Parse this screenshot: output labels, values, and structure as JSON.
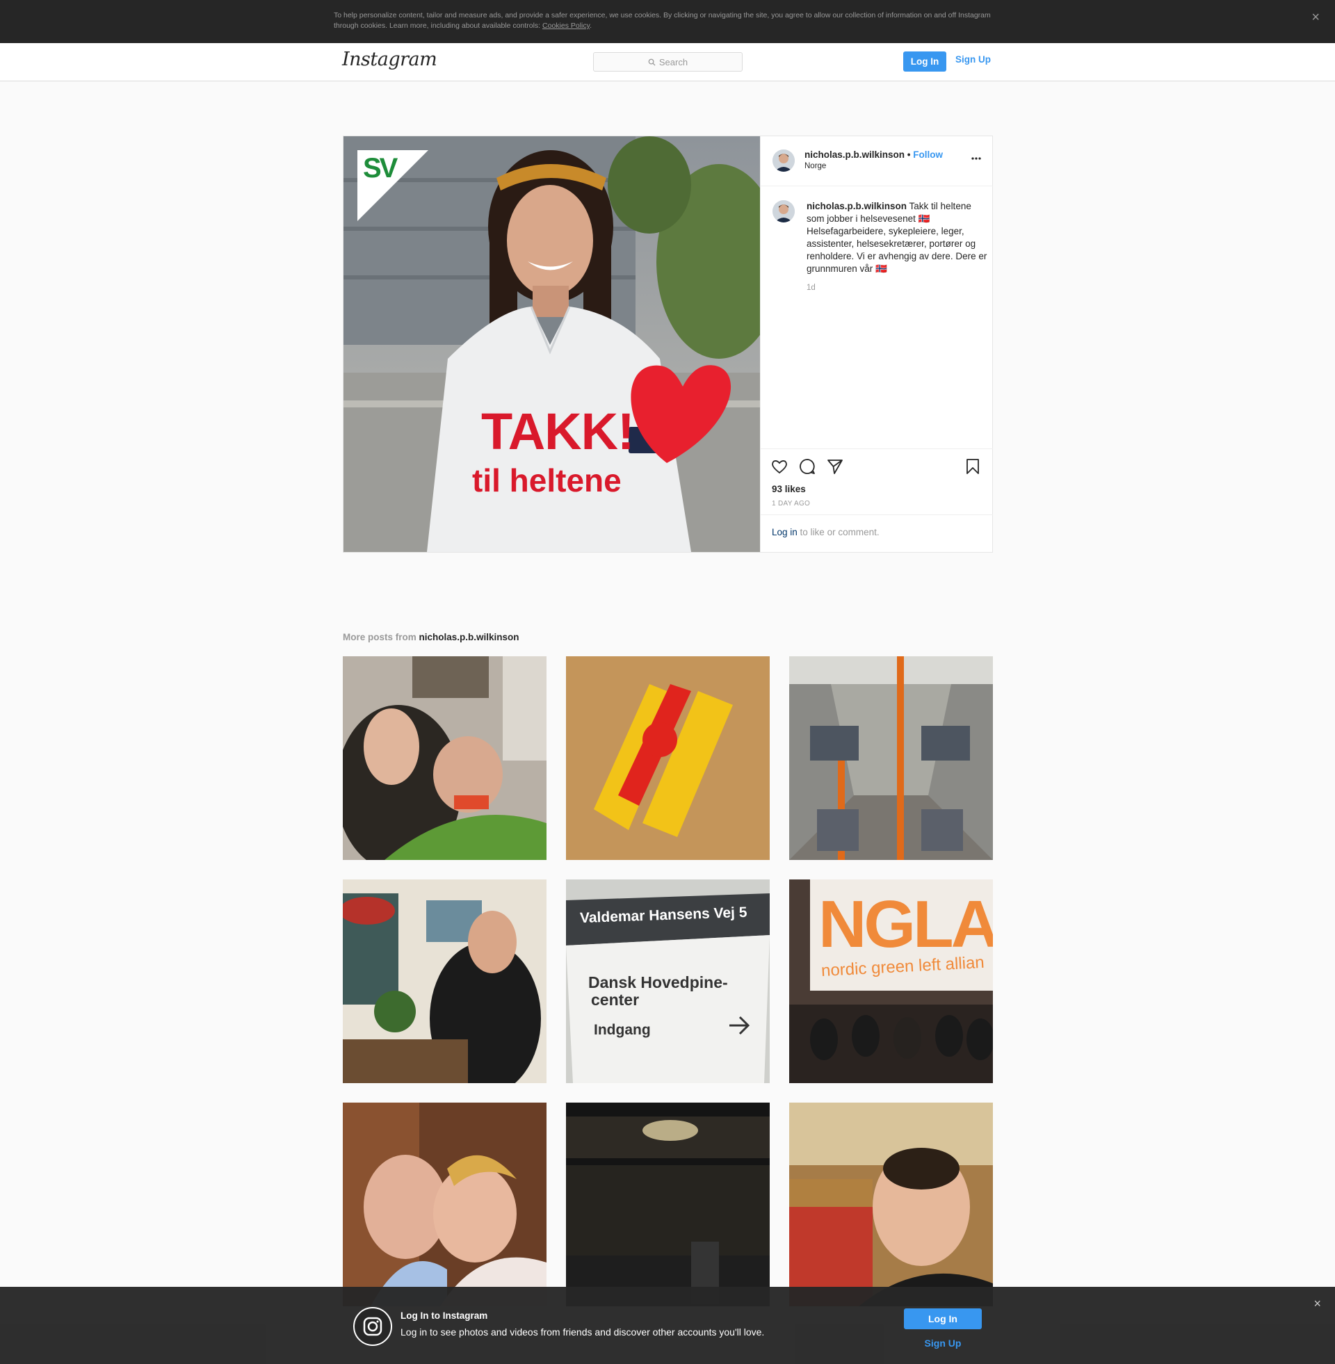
{
  "cookie_banner": {
    "text": "To help personalize content, tailor and measure ads, and provide a safer experience, we use cookies. By clicking or navigating the site, you agree to allow our collection of information on and off Instagram through cookies. Learn more, including about available controls: ",
    "link": "Cookies Policy",
    "end": ".",
    "close": "×"
  },
  "header": {
    "logo": "Instagram",
    "search_placeholder": "Search",
    "login": "Log In",
    "signup": "Sign Up"
  },
  "post": {
    "image_text_main": "TAKK!",
    "image_text_sub": "til heltene",
    "image_logo": "SV",
    "username": "nicholas.p.b.wilkinson",
    "dot": " • ",
    "follow": "Follow",
    "location": "Norge",
    "caption": " Takk til heltene som jobber i helsevesenet 🇳🇴 Helsefagarbeidere, sykepleiere, leger, assistenter, helsesekretærer, portører og renholdere. Vi er avhengig av dere. Dere er grunnmuren vår 🇳🇴",
    "caption_time": "1d",
    "likes": "93 likes",
    "time_ago": "1 DAY AGO",
    "login_link": "Log in",
    "login_rest": " to like or comment."
  },
  "more_posts": {
    "label": "More posts from ",
    "username": "nicholas.p.b.wilkinson",
    "tile3_sign1": "Valdemar Hansens Vej 5",
    "tile3_sign2": "Dansk Hovedpine-",
    "tile3_sign3": "center",
    "tile3_sign4": "Indgang",
    "tile4_big": "NGLA",
    "tile4_small": "nordic green left allian"
  },
  "bottom_banner": {
    "title": "Log In to Instagram",
    "desc": "Log in to see photos and videos from friends and discover other accounts you'll love.",
    "login": "Log In",
    "signup": "Sign Up",
    "close": "×"
  },
  "colors": {
    "accent": "#3897f0",
    "banner": "#262626",
    "heart_red": "#e8202e"
  }
}
